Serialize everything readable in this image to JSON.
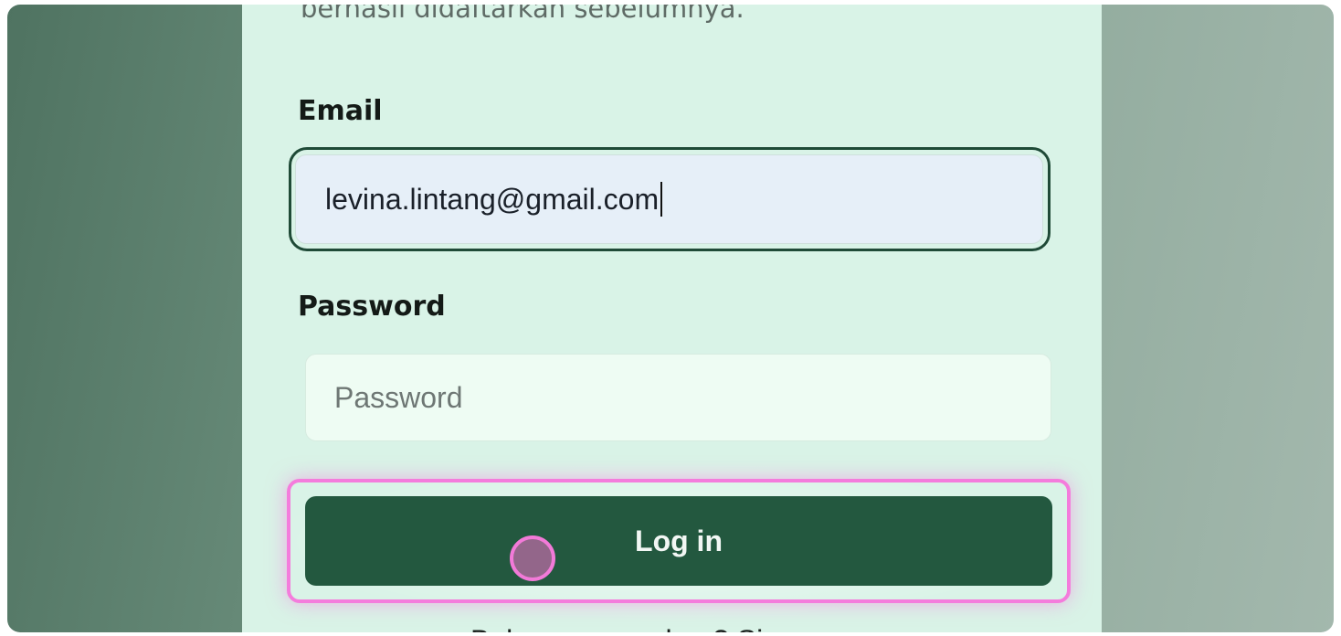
{
  "intro_text": "berhasil didaftarkan sebelumnya.",
  "email": {
    "label": "Email",
    "value": "levina.lintang@gmail.com"
  },
  "password": {
    "label": "Password",
    "placeholder": "Password",
    "value": ""
  },
  "login": {
    "label": "Log in"
  },
  "signup": {
    "text": "Belum punya akun? Sign up"
  },
  "colors": {
    "card_background": "#d9f3e7",
    "primary_button": "#23583f",
    "focus_ring": "#1f4a37",
    "highlight": "#f47cdc"
  }
}
